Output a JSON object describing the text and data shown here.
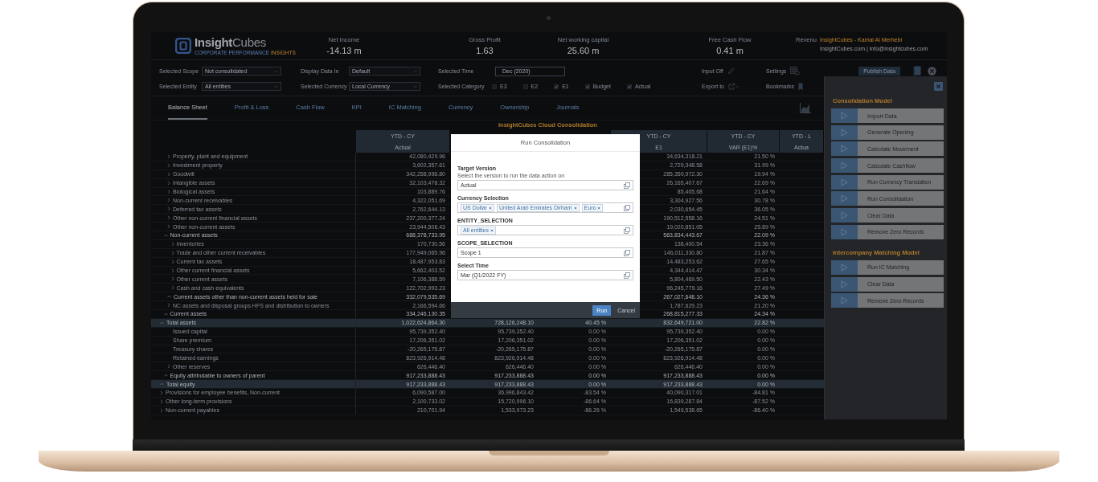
{
  "header": {
    "logo": {
      "wordmark": "**Insight**Cubes",
      "tagline": "CORPORATE PERFORMANCE",
      "tagline_accent": "INSIGHTS"
    },
    "kpis": [
      {
        "label": "Net Income",
        "value": "-14.13 m"
      },
      {
        "label": "Gross Profit",
        "value": "1.63"
      },
      {
        "label": "Net working capital",
        "value": "25.60 m"
      },
      {
        "label": "Free Cash Flow",
        "value": "0.41 m"
      },
      {
        "label": "Revenu"
      }
    ],
    "account": {
      "name": "InsightCubes - Kamal Al Merhebi",
      "contact": "InsightCubes.com | info@insightcubes.com"
    }
  },
  "filters": {
    "scope": {
      "label": "Selected Scope",
      "value": "Not consolidated"
    },
    "entity": {
      "label": "Selected Entity",
      "value": "All entities"
    },
    "display": {
      "label": "Display Data In",
      "value": "Default"
    },
    "currency": {
      "label": "Selected Currency",
      "value": "Local Currency"
    },
    "time": {
      "label": "Selected Time",
      "value": "Dec (2020)"
    },
    "category": {
      "label": "Selected Category",
      "options": [
        {
          "label": "E3",
          "checked": false
        },
        {
          "label": "E2",
          "checked": false
        },
        {
          "label": "E1",
          "checked": true
        },
        {
          "label": "Budget",
          "checked": true
        },
        {
          "label": "Actual",
          "checked": true
        }
      ]
    }
  },
  "tools": [
    {
      "label": "Input Off",
      "kind": "pencil"
    },
    {
      "label": "Export to",
      "kind": "export"
    },
    {
      "label": "Settings",
      "kind": "settings"
    },
    {
      "label": "Bookmarks",
      "kind": "bookmark"
    }
  ],
  "publish_button": "Publish Data",
  "tabs": [
    {
      "label": "Balance Sheet",
      "selected": true
    },
    {
      "label": "Profit & Loss",
      "selected": false
    },
    {
      "label": "Cash Flow",
      "selected": false
    },
    {
      "label": "KPI",
      "selected": false
    },
    {
      "label": "IC Matching",
      "selected": false
    },
    {
      "label": "Currency",
      "selected": false
    },
    {
      "label": "Ownership",
      "selected": false
    },
    {
      "label": "Journals",
      "selected": false
    }
  ],
  "table": {
    "title": "InsightCubes Cloud Consolidation",
    "columns": [
      {
        "kind": "shown",
        "period": "YTD - CY",
        "measure": "Actual"
      },
      {
        "kind": "covered"
      },
      {
        "kind": "covered"
      },
      {
        "kind": "shown",
        "period": "YTD - CY",
        "measure": "E1"
      },
      {
        "kind": "shown",
        "period": "YTD - CY",
        "measure": "VAR (E1)%"
      },
      {
        "kind": "shown",
        "period": "YTD - L",
        "measure": "Actua"
      }
    ],
    "rows": [
      {
        "label": "Total assets",
        "expanded": true,
        "highlighted": true,
        "ytd_cy_actual": "1,022,624,864.30",
        "column_3": "728,126,248.10",
        "column_4": "40.45 %",
        "ytd_cy_e1": "832,649,721.00",
        "ytd_cy_var_e1": "22.82 %",
        "children": [
          {
            "label": "Non-current assets",
            "expanded": true,
            "highlighted": false,
            "ytd_cy_actual": "688,378,733.95",
            "ytd_cy_e1": "563,834,443.67",
            "ytd_cy_var_e1": "22.09 %",
            "children": [
              {
                "label": "Property, plant and equipment",
                "expanded": false,
                "highlighted": false,
                "ytd_cy_actual": "42,080,429.96",
                "ytd_cy_e1": "34,634,318.21",
                "ytd_cy_var_e1": "21.50 %"
              },
              {
                "label": "Investment property",
                "expanded": false,
                "highlighted": false,
                "ytd_cy_actual": "3,602,357.61",
                "ytd_cy_e1": "2,729,348.58",
                "ytd_cy_var_e1": "31.99 %"
              },
              {
                "label": "Goodwill",
                "expanded": false,
                "highlighted": false,
                "ytd_cy_actual": "342,258,998.80",
                "ytd_cy_e1": "285,350,972.30",
                "ytd_cy_var_e1": "19.94 %"
              },
              {
                "label": "Intangible assets",
                "expanded": false,
                "highlighted": false,
                "ytd_cy_actual": "32,103,478.32",
                "ytd_cy_e1": "26,165,407.67",
                "ytd_cy_var_e1": "22.69 %"
              },
              {
                "label": "Biological assets",
                "expanded": false,
                "highlighted": false,
                "ytd_cy_actual": "103,889.76",
                "ytd_cy_e1": "85,405.68",
                "ytd_cy_var_e1": "21.64 %"
              },
              {
                "label": "Non-current receivables",
                "expanded": false,
                "highlighted": false,
                "ytd_cy_actual": "4,322,051.69",
                "ytd_cy_e1": "3,304,927.56",
                "ytd_cy_var_e1": "30.78 %"
              },
              {
                "label": "Deferred tax assets",
                "expanded": false,
                "highlighted": false,
                "ytd_cy_actual": "2,762,644.13",
                "ytd_cy_e1": "2,030,654.45",
                "ytd_cy_var_e1": "36.05 %"
              },
              {
                "label": "Other non-current financial assets",
                "expanded": false,
                "highlighted": false,
                "ytd_cy_actual": "237,200,377.24",
                "ytd_cy_e1": "190,512,558.16",
                "ytd_cy_var_e1": "24.51 %"
              },
              {
                "label": "Other non-current assets",
                "expanded": false,
                "highlighted": false,
                "ytd_cy_actual": "23,944,506.43",
                "ytd_cy_e1": "19,020,851.05",
                "ytd_cy_var_e1": "25.89 %"
              }
            ]
          },
          {
            "label": "Current assets",
            "expanded": true,
            "highlighted": false,
            "ytd_cy_actual": "334,246,130.35",
            "ytd_cy_e1": "268,815,277.33",
            "ytd_cy_var_e1": "24.34 %",
            "children": [
              {
                "label": "Current assets other than non-current assets held for sale",
                "expanded": true,
                "highlighted": false,
                "ytd_cy_actual": "332,079,535.69",
                "ytd_cy_e1": "267,027,648.10",
                "ytd_cy_var_e1": "24.36 %",
                "children": [
                  {
                    "label": "Inventories",
                    "expanded": false,
                    "highlighted": false,
                    "ytd_cy_actual": "170,730.56",
                    "ytd_cy_e1": "138,400.54",
                    "ytd_cy_var_e1": "23.36 %"
                  },
                  {
                    "label": "Trade and other current receivables",
                    "expanded": false,
                    "highlighted": false,
                    "ytd_cy_actual": "177,949,065.96",
                    "ytd_cy_e1": "146,011,330.80",
                    "ytd_cy_var_e1": "21.87 %"
                  },
                  {
                    "label": "Current tax assets",
                    "expanded": false,
                    "highlighted": false,
                    "ytd_cy_actual": "18,487,953.83",
                    "ytd_cy_e1": "14,483,253.62",
                    "ytd_cy_var_e1": "27.65 %"
                  },
                  {
                    "label": "Other current financial assets",
                    "expanded": false,
                    "highlighted": false,
                    "ytd_cy_actual": "5,662,403.52",
                    "ytd_cy_e1": "4,344,414.47",
                    "ytd_cy_var_e1": "30.34 %"
                  },
                  {
                    "label": "Other current assets",
                    "expanded": false,
                    "highlighted": false,
                    "ytd_cy_actual": "7,106,388.59",
                    "ytd_cy_e1": "5,804,469.50",
                    "ytd_cy_var_e1": "22.43 %"
                  },
                  {
                    "label": "Cash and cash equivalents",
                    "expanded": false,
                    "highlighted": false,
                    "ytd_cy_actual": "122,702,993.23",
                    "ytd_cy_e1": "96,245,779.16",
                    "ytd_cy_var_e1": "27.49 %"
                  }
                ]
              },
              {
                "label": "NC assets and disposal groups HFS and distribution to owners",
                "expanded": false,
                "highlighted": false,
                "ytd_cy_actual": "2,166,594.66",
                "ytd_cy_e1": "1,787,629.23",
                "ytd_cy_var_e1": "21.20 %"
              }
            ]
          }
        ]
      },
      {
        "label": "Total equity",
        "expanded": true,
        "highlighted": true,
        "ytd_cy_actual": "917,233,888.43",
        "column_3": "917,233,888.43",
        "column_4": "0.00 %",
        "ytd_cy_e1": "917,233,888.43",
        "ytd_cy_var_e1": "0.00 %",
        "children": [
          {
            "label": "Equity attributable to owners of parent",
            "expanded": true,
            "highlighted": false,
            "ytd_cy_actual": "917,233,888.43",
            "column_3": "917,233,888.43",
            "column_4": "0.00 %",
            "ytd_cy_e1": "917,233,888.43",
            "ytd_cy_var_e1": "0.00 %",
            "children": [
              {
                "label": "Issued capital",
                "highlighted": false,
                "ytd_cy_actual": "95,739,352.40",
                "column_3": "95,739,352.40",
                "column_4": "0.00 %",
                "ytd_cy_e1": "95,739,352.40",
                "ytd_cy_var_e1": "0.00 %"
              },
              {
                "label": "Share premium",
                "highlighted": false,
                "ytd_cy_actual": "17,206,351.02",
                "column_3": "17,206,351.02",
                "column_4": "0.00 %",
                "ytd_cy_e1": "17,206,351.02",
                "ytd_cy_var_e1": "0.00 %"
              },
              {
                "label": "Treasury shares",
                "highlighted": false,
                "ytd_cy_actual": "-20,265,175.87",
                "column_3": "-20,265,175.87",
                "column_4": "0.00 %",
                "ytd_cy_e1": "-20,265,175.87",
                "ytd_cy_var_e1": "0.00 %"
              },
              {
                "label": "Retained earnings",
                "highlighted": false,
                "ytd_cy_actual": "823,926,914.48",
                "column_3": "823,926,914.48",
                "column_4": "0.00 %",
                "ytd_cy_e1": "823,926,914.48",
                "ytd_cy_var_e1": "0.00 %"
              },
              {
                "label": "Other reserves",
                "expanded": false,
                "highlighted": false,
                "ytd_cy_actual": "626,446.40",
                "column_3": "626,446.40",
                "column_4": "0.00 %",
                "ytd_cy_e1": "626,446.40",
                "ytd_cy_var_e1": "0.00 %"
              }
            ]
          }
        ]
      },
      {
        "label": "Provisions for employee benefits, Non-current",
        "expanded": false,
        "highlighted": false,
        "ytd_cy_actual": "6,090,587.00",
        "column_3": "36,996,843.42",
        "column_4": "-83.54 %",
        "ytd_cy_e1": "40,090,317.01",
        "ytd_cy_var_e1": "-84.81 %"
      },
      {
        "label": "Other long-term provisions",
        "expanded": false,
        "highlighted": false,
        "ytd_cy_actual": "2,100,733.02",
        "column_3": "15,720,996.10",
        "column_4": "-86.64 %",
        "ytd_cy_e1": "16,839,287.84",
        "ytd_cy_var_e1": "-87.52 %"
      },
      {
        "label": "Non-current payables",
        "expanded": false,
        "highlighted": false,
        "ytd_cy_actual": "210,701.94",
        "column_3": "1,533,973.23",
        "column_4": "-86.26 %",
        "ytd_cy_e1": "1,549,538.65",
        "ytd_cy_var_e1": "-86.40 %"
      }
    ]
  },
  "dialog": {
    "title": "Run Consolidation",
    "fields": [
      {
        "label": "Target Version",
        "hint": "Select the version to run the data action on",
        "kind": "single",
        "value": "Actual"
      },
      {
        "label": "Currency Selection",
        "kind": "tokens",
        "tokens": [
          "US Dollar",
          "United Arab Emirates Dirham",
          "Euro"
        ]
      },
      {
        "label": "ENTITY_SELECTION",
        "kind": "tokens",
        "tokens": [
          "All entities"
        ]
      },
      {
        "label": "SCOPE_SELECTION",
        "kind": "single",
        "value": "Scope 1"
      },
      {
        "label": "Select Time",
        "kind": "single",
        "value": "Mar (Q1/2022 FY)"
      }
    ],
    "buttons": [
      {
        "label": "Run",
        "kind": "primary"
      },
      {
        "label": "Cancel",
        "kind": "plain"
      }
    ]
  },
  "panel": {
    "sections": [
      {
        "title": "Consolidation Model",
        "actions": [
          "Import Data",
          "Generate Opening",
          "Calculate Movement",
          "Calculate Cashflow",
          "Run Currency Translation",
          "Run Consolidation",
          "Clear Data",
          "Remove Zero Records"
        ]
      },
      {
        "title": "Intercompany Matching Model",
        "actions": [
          "Run IC Matching",
          "Clear Data",
          "Remove Zero Records"
        ]
      }
    ]
  }
}
